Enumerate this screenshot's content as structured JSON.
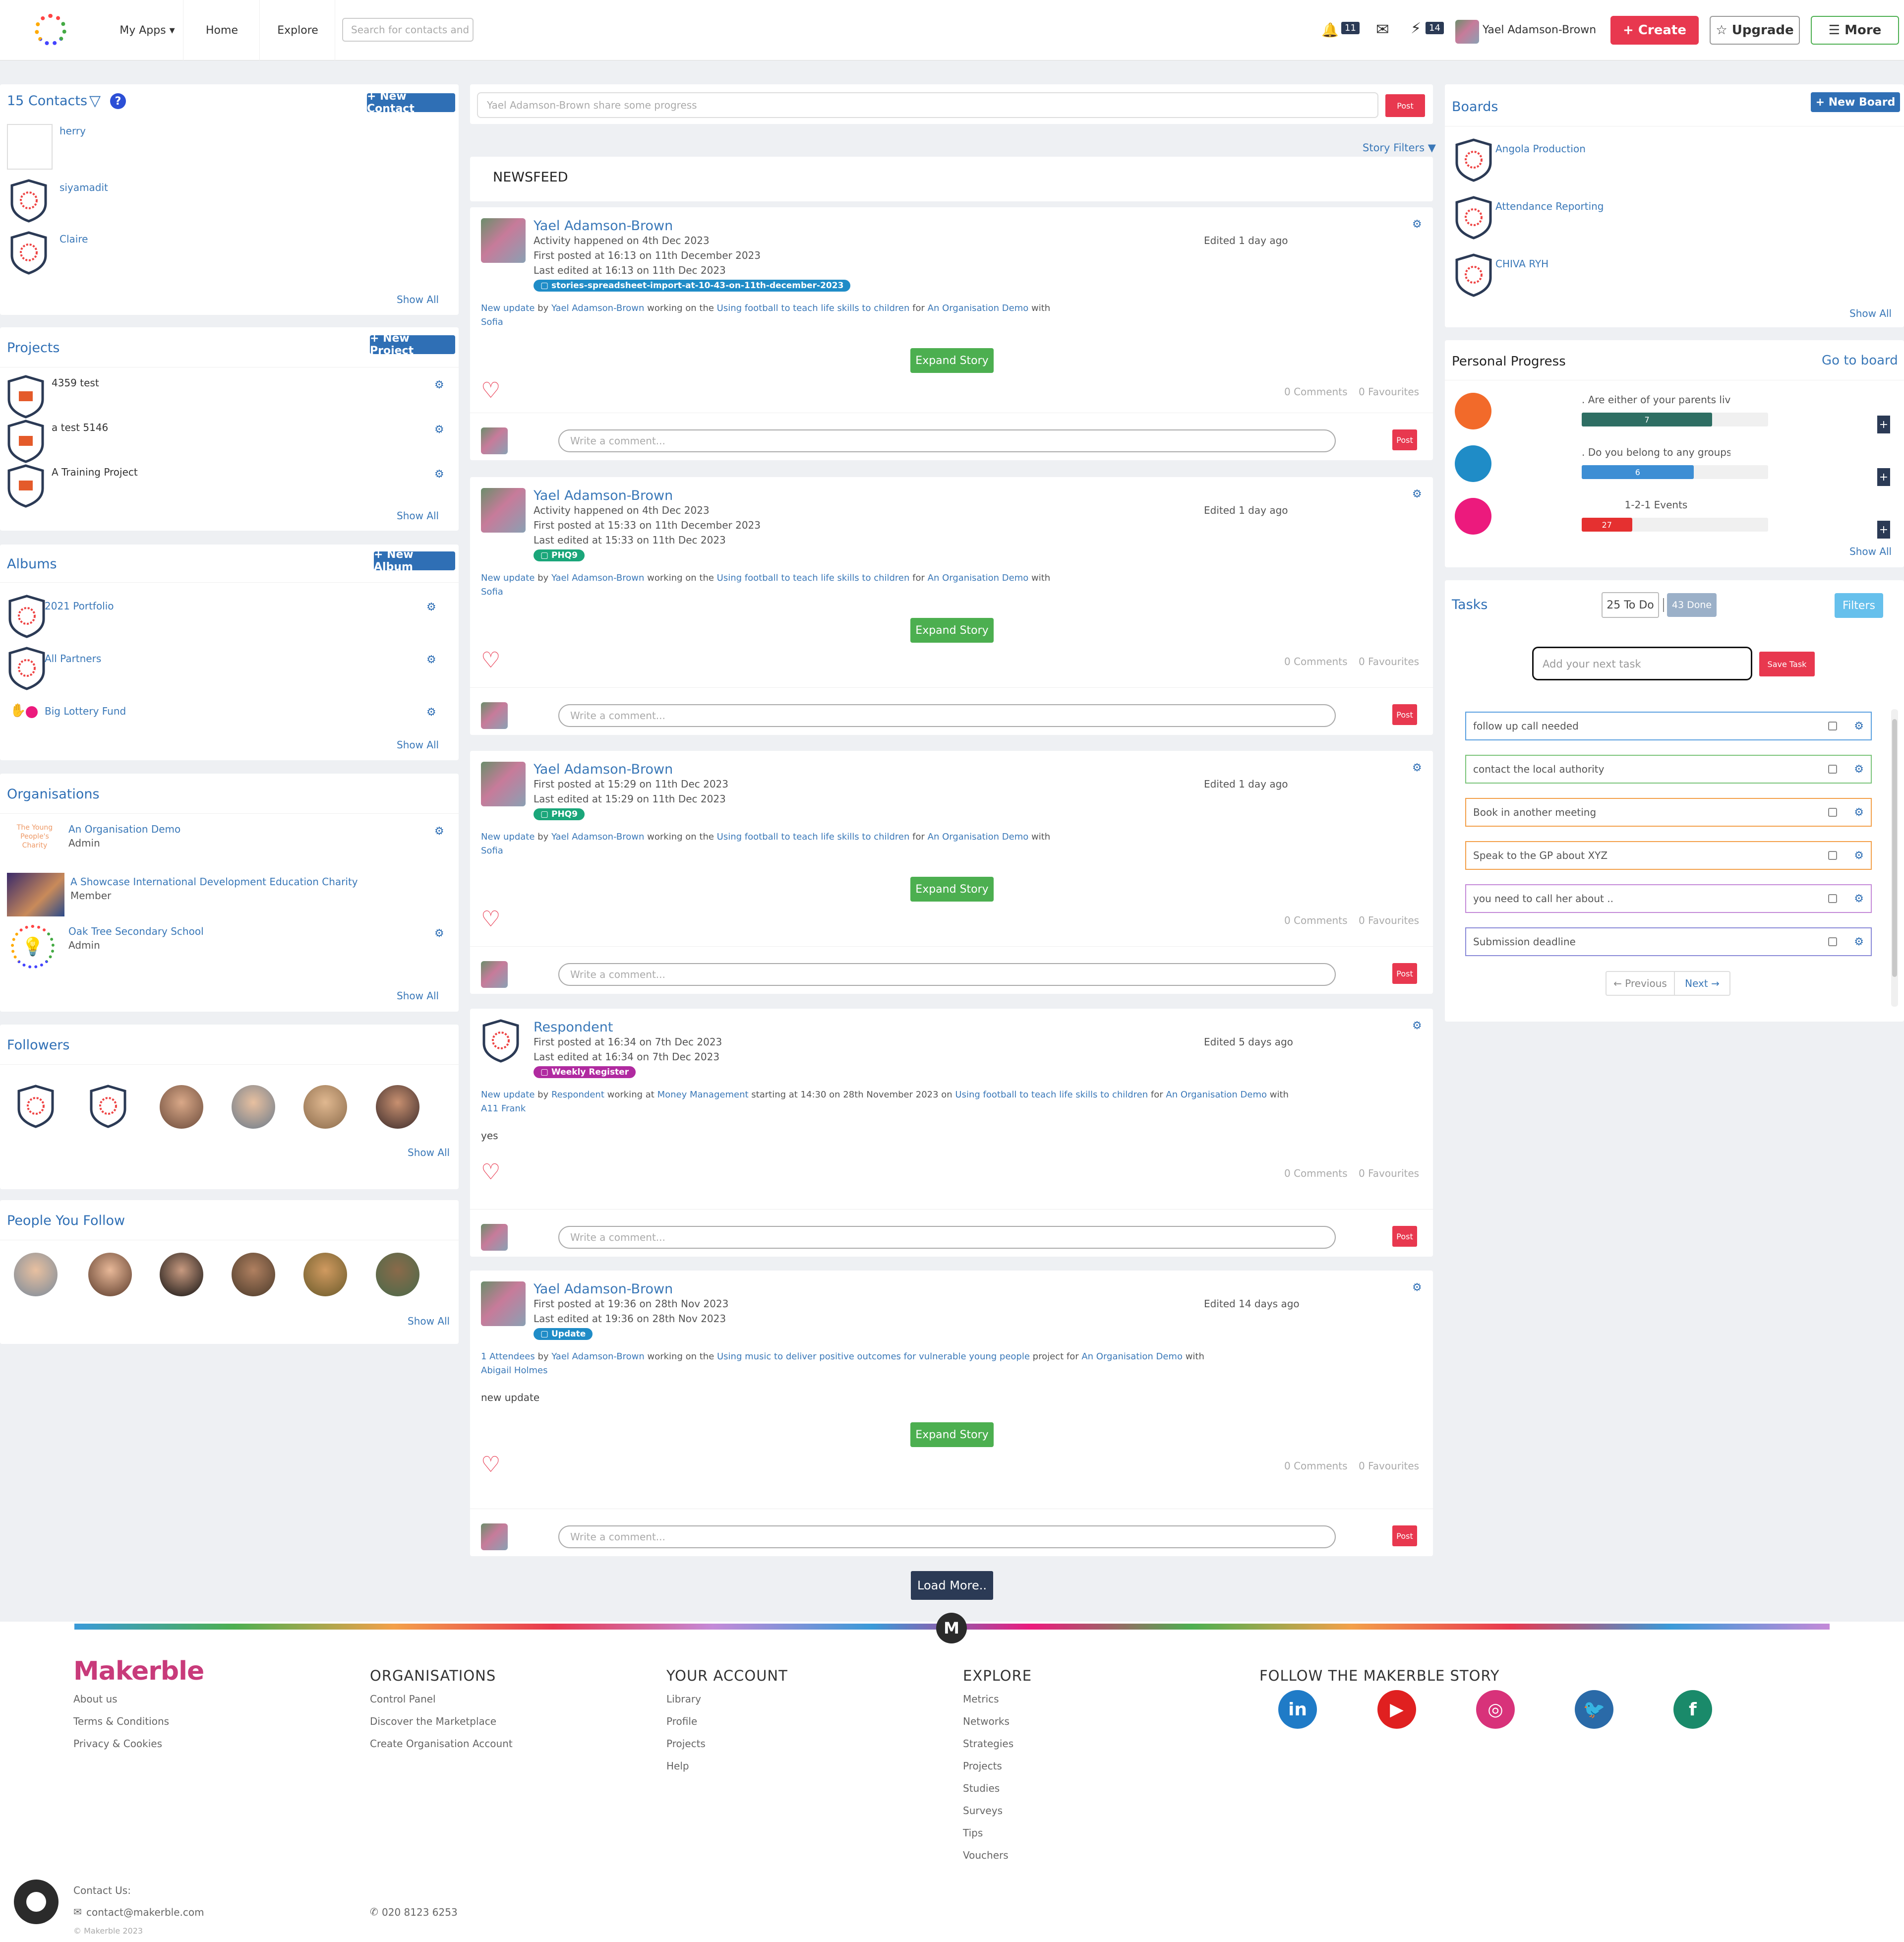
{
  "header": {
    "nav": [
      "My Apps ▾",
      "Home",
      "Explore"
    ],
    "search_placeholder": "Search for contacts and",
    "notif_count": "11",
    "flash_count": "14",
    "user_name": "Yael Adamson-Brown",
    "create_label": "+ Create",
    "upgrade_label": "☆ Upgrade",
    "more_label": "☰ More"
  },
  "contacts": {
    "title": "15 Contacts",
    "new_label": "+ New Contact",
    "items": [
      "herry",
      "siyamadit",
      "Claire"
    ],
    "show_all": "Show All"
  },
  "projects": {
    "title": "Projects",
    "new_label": "+ New Project",
    "items": [
      "4359 test",
      "a test 5146",
      "A Training Project"
    ],
    "show_all": "Show All"
  },
  "albums": {
    "title": "Albums",
    "new_label": "+ New Album",
    "items": [
      "2021 Portfolio",
      "All Partners",
      "Big Lottery Fund"
    ],
    "show_all": "Show All"
  },
  "organisations": {
    "title": "Organisations",
    "items": [
      {
        "name": "An Organisation Demo",
        "role": "Admin"
      },
      {
        "name": "A Showcase International Development Education Charity",
        "role": "Member"
      },
      {
        "name": "Oak Tree Secondary School",
        "role": "Admin"
      }
    ],
    "logo_text": "The Young People's Charity",
    "show_all": "Show All"
  },
  "followers": {
    "title": "Followers",
    "show_all": "Show All"
  },
  "people_follow": {
    "title": "People You Follow",
    "show_all": "Show All"
  },
  "composer": {
    "placeholder": "Yael Adamson-Brown share some progress",
    "post": "Post",
    "story_filters": "Story Filters ▼"
  },
  "newsfeed": {
    "title": "NEWSFEED",
    "comment_placeholder": "Write a comment...",
    "post": "Post",
    "expand": "Expand Story",
    "comments": "0 Comments",
    "favourites": "0 Favourites",
    "posts": [
      {
        "author": "Yael Adamson-Brown",
        "lines": [
          "Activity happened on 4th Dec 2023",
          "First posted at 16:13 on 11th December 2023",
          "Last edited at 16:13 on 11th Dec 2023"
        ],
        "edited": "Edited 1 day ago",
        "tag": "stories-spreadsheet-import-at-10-43-on-11th-december-2023",
        "desc_a": "New update",
        "desc_b": " by ",
        "desc_c": "Yael Adamson-Brown",
        "desc_d": " working on the ",
        "desc_e": "Using football to teach life skills to children",
        "desc_f": " for ",
        "desc_g": "An Organisation Demo",
        "desc_h": " with",
        "desc_2": "Sofia"
      },
      {
        "author": "Yael Adamson-Brown",
        "lines": [
          "Activity happened on 4th Dec 2023",
          "First posted at 15:33 on 11th December 2023",
          "Last edited at 15:33 on 11th Dec 2023"
        ],
        "edited": "Edited 1 day ago",
        "tag": "PHQ9",
        "desc_a": "New update",
        "desc_b": " by ",
        "desc_c": "Yael Adamson-Brown",
        "desc_d": " working on the ",
        "desc_e": "Using football to teach life skills to children",
        "desc_f": " for ",
        "desc_g": "An Organisation Demo",
        "desc_h": " with",
        "desc_2": "Sofia"
      },
      {
        "author": "Yael Adamson-Brown",
        "lines": [
          "First posted at 15:29 on 11th Dec 2023",
          "Last edited at 15:29 on 11th Dec 2023"
        ],
        "edited": "Edited 1 day ago",
        "tag": "PHQ9",
        "desc_a": "New update",
        "desc_b": " by ",
        "desc_c": "Yael Adamson-Brown",
        "desc_d": " working on the ",
        "desc_e": "Using football to teach life skills to children",
        "desc_f": " for ",
        "desc_g": "An Organisation Demo",
        "desc_h": " with",
        "desc_2": "Sofia"
      },
      {
        "author": "Respondent",
        "lines": [
          "First posted at 16:34 on 7th Dec 2023",
          "Last edited at 16:34 on 7th Dec 2023"
        ],
        "edited": "Edited 5 days ago",
        "tag": "Weekly Register",
        "desc_a": "New update",
        "desc_b": " by ",
        "desc_c": "Respondent",
        "desc_d": " working at ",
        "desc_e": "Money Management",
        "desc_f": " starting at 14:30 on 28th November 2023 on ",
        "desc_g": "Using football to teach life skills to children",
        "desc_h": " for ",
        "desc_i": "An Organisation Demo",
        "desc_j": " with",
        "desc_2": "A11 Frank",
        "body": "yes"
      },
      {
        "author": "Yael Adamson-Brown",
        "lines": [
          "First posted at 19:36 on 28th Nov 2023",
          "Last edited at 19:36 on 28th Nov 2023"
        ],
        "edited": "Edited 14 days ago",
        "tag": "Update",
        "desc_a": "1 Attendees",
        "desc_b": " by ",
        "desc_c": "Yael Adamson-Brown",
        "desc_d": " working on the ",
        "desc_e": "Using music to deliver positive outcomes for vulnerable young people",
        "desc_f": " project for ",
        "desc_g": "An Organisation Demo",
        "desc_h": " with",
        "desc_2": "Abigail Holmes",
        "body": "new update"
      }
    ],
    "load_more": "Load More.."
  },
  "boards": {
    "title": "Boards",
    "new_label": "+ New Board",
    "items": [
      "Angola Production",
      "Attendance Reporting",
      "CHIVA RYH"
    ],
    "show_all": "Show All"
  },
  "progress": {
    "title": "Personal Progress",
    "goto": "Go to board",
    "items": [
      {
        "label": ". Are either of your parents living?",
        "value": "7",
        "fill": 0.7,
        "color": "#2e6e63",
        "dot": "#f26a2a"
      },
      {
        "label": ". Do you belong to any groups in whi...",
        "value": "6",
        "fill": 0.6,
        "color": "#3d8ed4",
        "dot": "#1f8cc7"
      },
      {
        "label": "1-2-1 Events",
        "value": "27",
        "fill": 0.27,
        "color": "#e53030",
        "dot": "#ec1a7d"
      }
    ],
    "show_all": "Show All"
  },
  "tasks": {
    "title": "Tasks",
    "todo": "25 To Do",
    "done": "43 Done",
    "filters": "Filters",
    "placeholder": "Add your next task",
    "save": "Save Task",
    "items": [
      {
        "label": "follow up call needed",
        "color": "#5aa0e0"
      },
      {
        "label": "contact the local authority",
        "color": "#7bc47a"
      },
      {
        "label": "Book in another meeting",
        "color": "#f3a04a"
      },
      {
        "label": "Speak to the GP about XYZ",
        "color": "#f3a04a"
      },
      {
        "label": "you need to call her about ..",
        "color": "#c48ad8"
      },
      {
        "label": "Submission deadline",
        "color": "#8a8ad8"
      }
    ],
    "prev": "← Previous",
    "next": "Next →"
  },
  "footer": {
    "brand": "Makerble",
    "col1": [
      "About us",
      "Terms & Conditions",
      "Privacy & Cookies"
    ],
    "h2": "ORGANISATIONS",
    "col2": [
      "Control Panel",
      "Discover the Marketplace",
      "Create Organisation Account"
    ],
    "h3": "YOUR ACCOUNT",
    "col3": [
      "Library",
      "Profile",
      "Projects",
      "Help"
    ],
    "h4": "EXPLORE",
    "col4": [
      "Metrics",
      "Networks",
      "Strategies",
      "Projects",
      "Studies",
      "Surveys",
      "Tips",
      "Vouchers"
    ],
    "h5": "FOLLOW THE MAKERBLE STORY",
    "contact_label": "Contact Us:",
    "email": "contact@makerble.com",
    "phone": "020 8123 6253",
    "copyright": "© Makerble 2023"
  }
}
